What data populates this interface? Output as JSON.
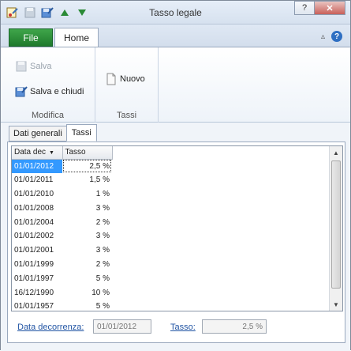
{
  "window": {
    "title": "Tasso legale"
  },
  "ribbon": {
    "file_tab": "File",
    "home_tab": "Home",
    "groups": [
      {
        "label": "Modifica",
        "buttons": [
          {
            "label": "Salva",
            "disabled": true
          },
          {
            "label": "Salva e chiudi"
          }
        ]
      },
      {
        "label": "Tassi",
        "buttons": [
          {
            "label": "Nuovo"
          }
        ]
      }
    ]
  },
  "tabs": [
    "Dati generali",
    "Tassi"
  ],
  "grid": {
    "columns": [
      "Data dec",
      "Tasso"
    ],
    "rows": [
      {
        "date": "01/01/2012",
        "rate": "2,5 %",
        "selected": true
      },
      {
        "date": "01/01/2011",
        "rate": "1,5 %"
      },
      {
        "date": "01/01/2010",
        "rate": "1 %"
      },
      {
        "date": "01/01/2008",
        "rate": "3 %"
      },
      {
        "date": "01/01/2004",
        "rate": "2 %"
      },
      {
        "date": "01/01/2002",
        "rate": "3 %"
      },
      {
        "date": "01/01/2001",
        "rate": "3 %"
      },
      {
        "date": "01/01/1999",
        "rate": "2 %"
      },
      {
        "date": "01/01/1997",
        "rate": "5 %"
      },
      {
        "date": "16/12/1990",
        "rate": "10 %"
      },
      {
        "date": "01/01/1957",
        "rate": "5 %"
      }
    ]
  },
  "fields": {
    "date_label": "Data decorrenza:",
    "date_value": "01/01/2012",
    "rate_label": "Tasso:",
    "rate_value": "2,5 %"
  },
  "colors": {
    "selection": "#3399ff",
    "file_tab": "#2a8a36",
    "link_label": "#2255a4"
  },
  "icons": [
    "properties-icon",
    "save-icon",
    "save-close-icon",
    "arrow-up-icon",
    "arrow-down-icon",
    "help-icon",
    "new-document-icon"
  ]
}
